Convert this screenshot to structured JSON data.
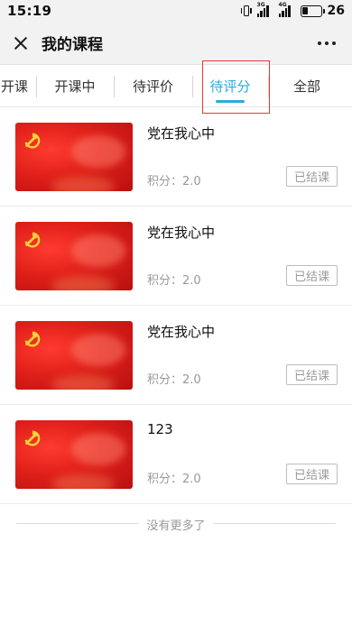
{
  "status_bar": {
    "time": "15:19",
    "network_1": "3G",
    "network_2": "4G",
    "battery": "26"
  },
  "header": {
    "title": "我的课程",
    "close_icon": "close-icon",
    "more_icon": "more-icon"
  },
  "tabs": [
    {
      "label": "开课"
    },
    {
      "label": "开课中"
    },
    {
      "label": "待评价"
    },
    {
      "label": "待评分",
      "active": true
    },
    {
      "label": "全部"
    }
  ],
  "courses": [
    {
      "title": "党在我心中",
      "score": "积分：2.0",
      "status": "已结课"
    },
    {
      "title": "党在我心中",
      "score": "积分：2.0",
      "status": "已结课"
    },
    {
      "title": "党在我心中",
      "score": "积分：2.0",
      "status": "已结课"
    },
    {
      "title": "123",
      "score": "积分：2.0",
      "status": "已结课"
    }
  ],
  "footer": {
    "no_more": "没有更多了"
  },
  "colors": {
    "accent": "#29a9e0",
    "highlight_box": "#e53935",
    "thumbnail_red": "#e0201a"
  }
}
